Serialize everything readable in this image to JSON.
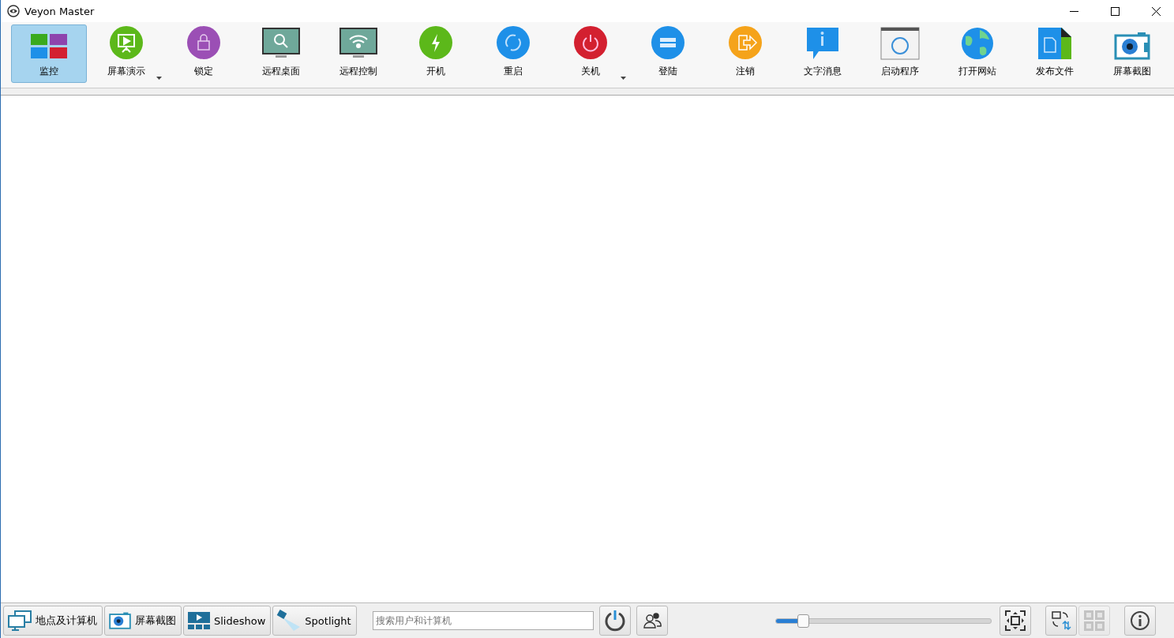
{
  "window": {
    "title": "Veyon Master"
  },
  "toolbar": [
    {
      "kind": "monitor",
      "label": "监控",
      "selected": true,
      "menu": false
    },
    {
      "kind": "demo",
      "label": "屏幕演示",
      "selected": false,
      "menu": true
    },
    {
      "kind": "lock",
      "label": "锁定",
      "selected": false,
      "menu": false
    },
    {
      "kind": "remote-view",
      "label": "远程桌面",
      "selected": false,
      "menu": false
    },
    {
      "kind": "remote-control",
      "label": "远程控制",
      "selected": false,
      "menu": false
    },
    {
      "kind": "power-on",
      "label": "开机",
      "selected": false,
      "menu": false
    },
    {
      "kind": "reboot",
      "label": "重启",
      "selected": false,
      "menu": false
    },
    {
      "kind": "power-off",
      "label": "关机",
      "selected": false,
      "menu": true
    },
    {
      "kind": "logon",
      "label": "登陆",
      "selected": false,
      "menu": false
    },
    {
      "kind": "logoff",
      "label": "注销",
      "selected": false,
      "menu": false
    },
    {
      "kind": "message",
      "label": "文字消息",
      "selected": false,
      "menu": false
    },
    {
      "kind": "run",
      "label": "启动程序",
      "selected": false,
      "menu": false
    },
    {
      "kind": "website",
      "label": "打开网站",
      "selected": false,
      "menu": false
    },
    {
      "kind": "file",
      "label": "发布文件",
      "selected": false,
      "menu": false
    },
    {
      "kind": "screenshot",
      "label": "屏幕截图",
      "selected": false,
      "menu": false
    }
  ],
  "bottom_buttons": [
    {
      "kind": "locations",
      "label": "地点及计算机"
    },
    {
      "kind": "screenshot",
      "label": "屏幕截图"
    },
    {
      "kind": "slideshow",
      "label": "Slideshow"
    },
    {
      "kind": "spotlight",
      "label": "Spotlight"
    }
  ],
  "search": {
    "placeholder": "搜索用户和计算机"
  },
  "zoom_slider": {
    "level": 0.12
  },
  "grid_button": {
    "disabled": true
  }
}
